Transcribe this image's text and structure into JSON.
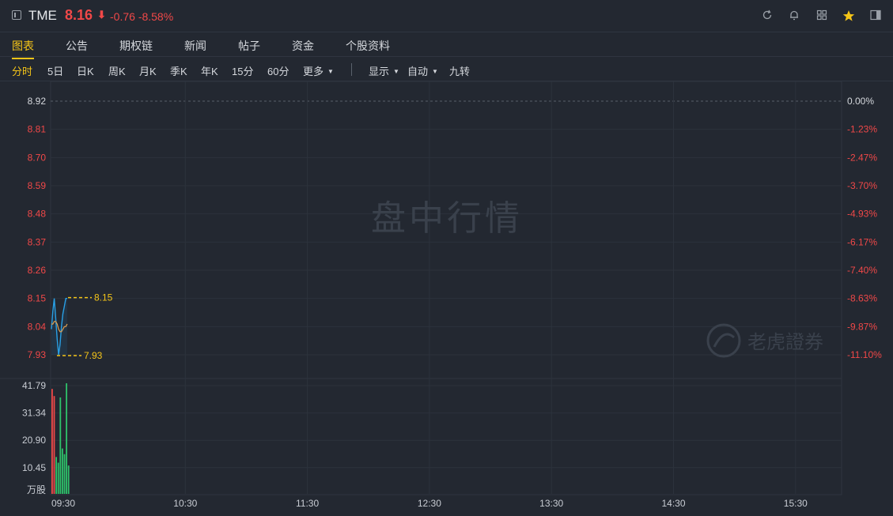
{
  "header": {
    "symbol": "TME",
    "price": "8.16",
    "arrow": "⬇",
    "change": "-0.76",
    "change_pct": "-8.58%",
    "icons": [
      "refresh-icon",
      "bell-icon",
      "grid-icon",
      "star-icon",
      "sidebar-icon"
    ],
    "colors": {
      "down": "#f04848",
      "accent": "#f5c518"
    }
  },
  "tabs": [
    "图表",
    "公告",
    "期权链",
    "新闻",
    "帖子",
    "资金",
    "个股资料"
  ],
  "active_tab": "图表",
  "toolbar": {
    "periods": [
      "分时",
      "5日",
      "日K",
      "周K",
      "月K",
      "季K",
      "年K",
      "15分",
      "60分"
    ],
    "active": "分时",
    "more": "更多",
    "display": "显示",
    "auto": "自动",
    "rights": "九转"
  },
  "watermarks": {
    "main": "盘中行情",
    "brand": "老虎證券"
  },
  "chart_data": {
    "type": "line",
    "price_axis_left": [
      "8.92",
      "8.81",
      "8.70",
      "8.59",
      "8.48",
      "8.37",
      "8.26",
      "8.15",
      "8.04",
      "7.93"
    ],
    "pct_axis_right": [
      "0.00%",
      "-1.23%",
      "-2.47%",
      "-3.70%",
      "-4.93%",
      "-6.17%",
      "-7.40%",
      "-8.63%",
      "-9.87%",
      "-11.10%"
    ],
    "ylim": [
      7.93,
      8.92
    ],
    "volume_axis": [
      "41.79",
      "31.34",
      "20.90",
      "10.45"
    ],
    "volume_unit": "万股",
    "volume_ylim": [
      0,
      41.79
    ],
    "x_ticks": [
      "09:30",
      "10:30",
      "11:30",
      "12:30",
      "13:30",
      "14:30",
      "15:30"
    ],
    "high_label": "8.15",
    "low_label": "7.93",
    "price_series": [
      8.03,
      8.1,
      8.15,
      8.07,
      7.99,
      7.93,
      7.97,
      8.04,
      8.09,
      8.12,
      8.15,
      8.15
    ],
    "avg_series": [
      8.05,
      8.05,
      8.06,
      8.06,
      8.05,
      8.03,
      8.02,
      8.02,
      8.03,
      8.04,
      8.04,
      8.05
    ],
    "volume_bars": [
      {
        "v": 37.0,
        "d": "up"
      },
      {
        "v": 34.5,
        "d": "up"
      },
      {
        "v": 13.0,
        "d": "down"
      },
      {
        "v": 11.0,
        "d": "down"
      },
      {
        "v": 34.0,
        "d": "down"
      },
      {
        "v": 16.0,
        "d": "down"
      },
      {
        "v": 14.0,
        "d": "down"
      },
      {
        "v": 39.0,
        "d": "down"
      },
      {
        "v": 10.0,
        "d": "down"
      }
    ]
  }
}
